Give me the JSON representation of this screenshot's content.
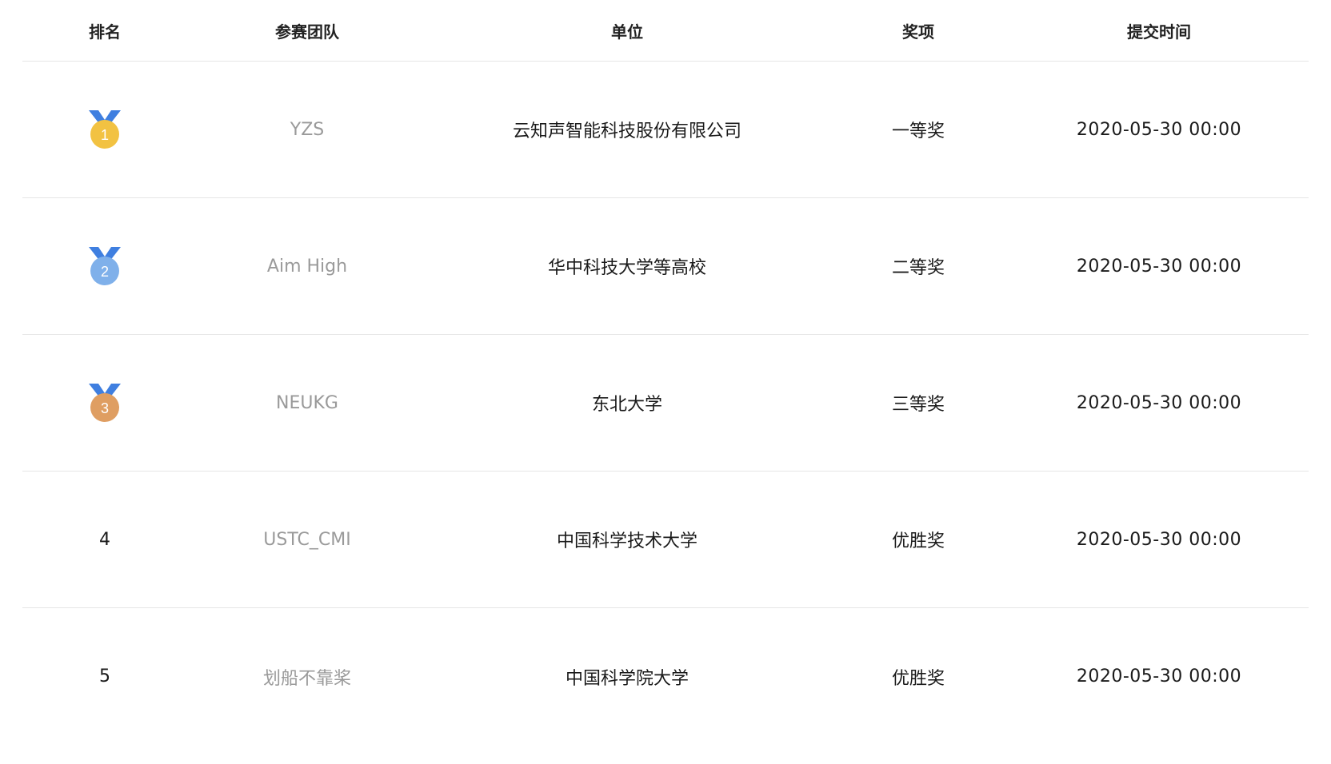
{
  "columns": {
    "rank": "排名",
    "team": "参赛团队",
    "org": "单位",
    "award": "奖项",
    "time": "提交时间"
  },
  "medal_colors": {
    "ribbon": "#3f7fe0",
    "gold": "#f2c242",
    "silver": "#7fb0ea",
    "bronze": "#df9e62"
  },
  "rows": [
    {
      "rank": "1",
      "medal": "gold-medal-icon",
      "team": "YZS",
      "org": "云知声智能科技股份有限公司",
      "award": "一等奖",
      "time": "2020-05-30 00:00"
    },
    {
      "rank": "2",
      "medal": "silver-medal-icon",
      "team": "Aim High",
      "org": "华中科技大学等高校",
      "award": "二等奖",
      "time": "2020-05-30 00:00"
    },
    {
      "rank": "3",
      "medal": "bronze-medal-icon",
      "team": "NEUKG",
      "org": "东北大学",
      "award": "三等奖",
      "time": "2020-05-30 00:00"
    },
    {
      "rank": "4",
      "team": "USTC_CMI",
      "org": "中国科学技术大学",
      "award": "优胜奖",
      "time": "2020-05-30 00:00"
    },
    {
      "rank": "5",
      "team": "划船不靠桨",
      "org": "中国科学院大学",
      "award": "优胜奖",
      "time": "2020-05-30 00:00"
    }
  ]
}
